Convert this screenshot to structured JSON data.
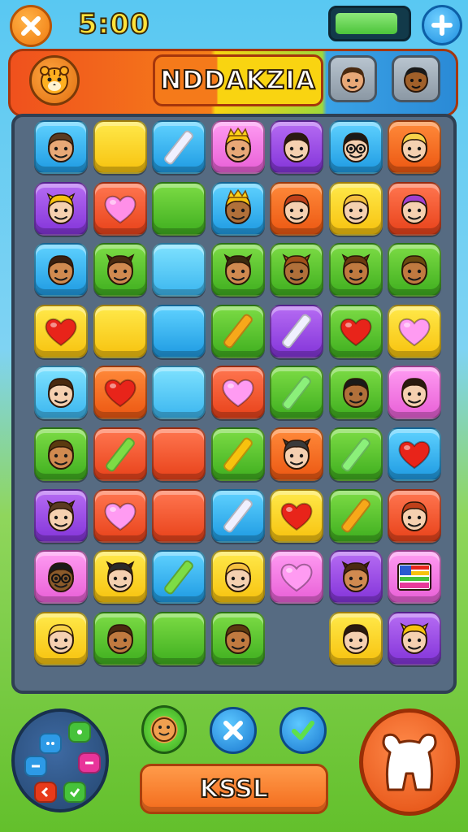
{
  "topbar": {
    "close_icon": "close-icon",
    "timer": "5:00",
    "energy_level": 0.9,
    "energy_color": "#5fd24a",
    "plus_icon": "plus-icon"
  },
  "header": {
    "title": "NDDAKZIA",
    "mascot_icon": "tiger-icon",
    "players": [
      "player-avatar-boy",
      "player-avatar-girl"
    ]
  },
  "board": {
    "columns": 7,
    "rows": 9,
    "tiles": [
      [
        {
          "c": "blue",
          "t": "face",
          "skin": "#e8a877",
          "hair": "#5a3a20"
        },
        {
          "c": "yellow",
          "t": "empty"
        },
        {
          "c": "blue",
          "t": "stick",
          "s": "#f0f0ff"
        },
        {
          "c": "pink",
          "t": "face",
          "skin": "#e8a877",
          "hair": "#f7c20e",
          "crown": true
        },
        {
          "c": "purple",
          "t": "face",
          "skin": "#f5d0b0",
          "hair": "#2a1a10"
        },
        {
          "c": "blue",
          "t": "face",
          "skin": "#f5d0b0",
          "hair": "#1a1a1a",
          "glasses": true
        },
        {
          "c": "orange",
          "t": "face",
          "skin": "#f5d0b0",
          "hair": "#f7d24a"
        }
      ],
      [
        {
          "c": "purple",
          "t": "face",
          "skin": "#f5d0b0",
          "hair": "#f7c20e",
          "ears": true
        },
        {
          "c": "red",
          "t": "heart",
          "h": "#ff8fe8"
        },
        {
          "c": "green",
          "t": "empty"
        },
        {
          "c": "blue",
          "t": "face",
          "skin": "#b0703a",
          "hair": "#f7c20e",
          "crown": true
        },
        {
          "c": "orange",
          "t": "face",
          "skin": "#f5d0b0",
          "hair": "#c0401a"
        },
        {
          "c": "yellow",
          "t": "face",
          "skin": "#f5d0b0",
          "hair": "#f5c040"
        },
        {
          "c": "red",
          "t": "face",
          "skin": "#f5d0b0",
          "hair": "#a040d0"
        }
      ],
      [
        {
          "c": "blue",
          "t": "face",
          "skin": "#d08a50",
          "hair": "#3a2010"
        },
        {
          "c": "green",
          "t": "face",
          "skin": "#d08a50",
          "hair": "#4a2a10",
          "ears": true
        },
        {
          "c": "ltblue",
          "t": "empty"
        },
        {
          "c": "green",
          "t": "face",
          "skin": "#d08a50",
          "hair": "#3a2a10",
          "ears": true
        },
        {
          "c": "green",
          "t": "face",
          "skin": "#b0703a",
          "hair": "#a0501a",
          "ears": true
        },
        {
          "c": "green",
          "t": "face",
          "skin": "#c07a40",
          "hair": "#6a3a10",
          "ears": true
        },
        {
          "c": "green",
          "t": "face",
          "skin": "#c07a40",
          "hair": "#6a4a10"
        }
      ],
      [
        {
          "c": "yellow",
          "t": "heart",
          "h": "#e8241a"
        },
        {
          "c": "yellow",
          "t": "empty"
        },
        {
          "c": "blue",
          "t": "empty"
        },
        {
          "c": "green",
          "t": "stick",
          "s": "#f7a81a"
        },
        {
          "c": "purple",
          "t": "stick",
          "s": "#f0f0ff"
        },
        {
          "c": "green",
          "t": "heart",
          "h": "#e8241a"
        },
        {
          "c": "yellow",
          "t": "heart",
          "h": "#ff9bf2"
        }
      ],
      [
        {
          "c": "ltblue",
          "t": "face",
          "skin": "#f5d0b0",
          "hair": "#4a2a10"
        },
        {
          "c": "orange",
          "t": "heart",
          "h": "#e8241a"
        },
        {
          "c": "ltblue",
          "t": "empty"
        },
        {
          "c": "red",
          "t": "heart",
          "h": "#ff9bf2"
        },
        {
          "c": "green",
          "t": "stick",
          "s": "#8bf07a"
        },
        {
          "c": "green",
          "t": "face",
          "skin": "#b0703a",
          "hair": "#1a1a1a"
        },
        {
          "c": "pink",
          "t": "face",
          "skin": "#f5d0b0",
          "hair": "#2a1a10"
        }
      ],
      [
        {
          "c": "green",
          "t": "face",
          "skin": "#d08a50",
          "hair": "#5a3a10"
        },
        {
          "c": "red",
          "t": "stick",
          "s": "#7ddc45"
        },
        {
          "c": "red",
          "t": "empty"
        },
        {
          "c": "green",
          "t": "stick",
          "s": "#f7c20e"
        },
        {
          "c": "orange",
          "t": "face",
          "skin": "#f5d0b0",
          "hair": "#3a3a3a",
          "ears": true
        },
        {
          "c": "green",
          "t": "stick",
          "s": "#8bf07a"
        },
        {
          "c": "blue",
          "t": "heart",
          "h": "#e8241a"
        }
      ],
      [
        {
          "c": "purple",
          "t": "face",
          "skin": "#f5d0b0",
          "hair": "#5a3a20",
          "ears": true
        },
        {
          "c": "red",
          "t": "heart",
          "h": "#ff9bf2"
        },
        {
          "c": "red",
          "t": "empty"
        },
        {
          "c": "blue",
          "t": "stick",
          "s": "#f0f0ff"
        },
        {
          "c": "yellow",
          "t": "heart",
          "h": "#e8241a"
        },
        {
          "c": "green",
          "t": "stick",
          "s": "#f7a81a"
        },
        {
          "c": "red",
          "t": "face",
          "skin": "#f5d0b0",
          "hair": "#c0401a"
        }
      ],
      [
        {
          "c": "pink",
          "t": "face",
          "skin": "#8a5a2a",
          "hair": "#1a1a1a",
          "glasses": true
        },
        {
          "c": "yellow",
          "t": "face",
          "skin": "#f5d0b0",
          "hair": "#2a2a2a",
          "ears": true
        },
        {
          "c": "blue",
          "t": "stick",
          "s": "#7ddc45"
        },
        {
          "c": "yellow",
          "t": "face",
          "skin": "#f5d0b0",
          "hair": "#f5c040"
        },
        {
          "c": "pink",
          "t": "heart",
          "h": "#ff9bf2"
        },
        {
          "c": "purple",
          "t": "face",
          "skin": "#d08a50",
          "hair": "#4a2a10",
          "ears": true
        },
        {
          "c": "pink",
          "t": "flag"
        }
      ],
      [
        {
          "c": "yellow",
          "t": "face",
          "skin": "#f5d0b0",
          "hair": "#f7d24a"
        },
        {
          "c": "green",
          "t": "face",
          "skin": "#c07a40",
          "hair": "#4a2a10"
        },
        {
          "c": "green",
          "t": "empty"
        },
        {
          "c": "green",
          "t": "face",
          "skin": "#c07a40",
          "hair": "#5a3a10"
        },
        null,
        {
          "c": "yellow",
          "t": "face",
          "skin": "#f5d0b0",
          "hair": "#2a1a10"
        },
        {
          "c": "purple",
          "t": "face",
          "skin": "#f5d0b0",
          "hair": "#f7c20e",
          "ears": true
        }
      ]
    ]
  },
  "controls": {
    "dpad_icon": "dpad-icon",
    "face_button_icon": "face-icon",
    "cancel_icon": "x-icon",
    "confirm_icon": "checkmark-icon",
    "action_label": "KSSL",
    "big_button_icon": "bear-icon"
  }
}
